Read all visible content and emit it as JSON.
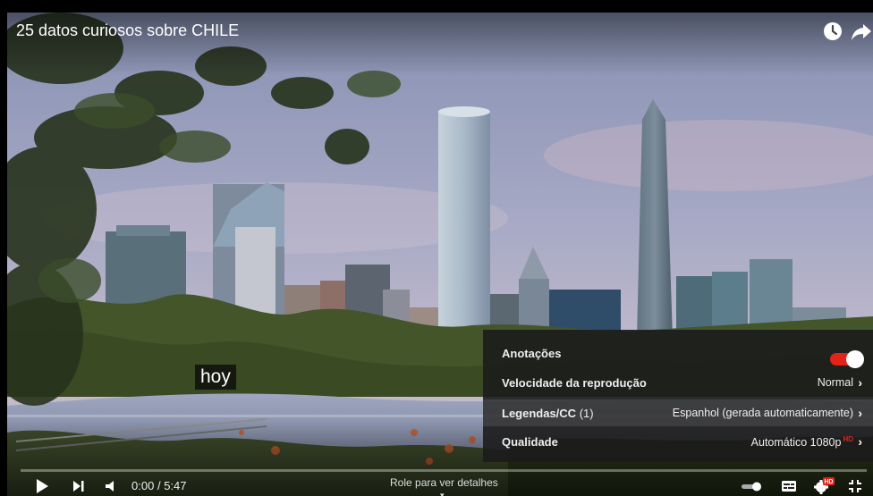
{
  "video": {
    "title": "25 datos curiosos sobre CHILE",
    "caption": "hoy",
    "time_current": "0:00",
    "time_separator": "/",
    "time_total": "5:47",
    "scroll_hint": "Role para ver detalhes",
    "progress": 0
  },
  "top_actions": [
    {
      "name": "watch-later-icon"
    },
    {
      "name": "share-icon"
    }
  ],
  "settings": {
    "annotations": {
      "label": "Anotações",
      "enabled": true
    },
    "speed": {
      "label": "Velocidade da reprodução",
      "value": "Normal"
    },
    "captions": {
      "label": "Legendas/CC",
      "count": "(1)",
      "value": "Espanhol (gerada automaticamente)"
    },
    "quality": {
      "label": "Qualidade",
      "value": "Automático 1080p",
      "badge": "HD"
    }
  },
  "controls": [
    {
      "name": "play-icon"
    },
    {
      "name": "next-icon"
    },
    {
      "name": "volume-icon"
    },
    {
      "name": "autoplay-toggle-icon"
    },
    {
      "name": "subtitles-icon"
    },
    {
      "name": "settings-gear-icon"
    },
    {
      "name": "exit-fullscreen-icon"
    }
  ],
  "colors": {
    "accent": "#e62117",
    "panel": "#1c1c1c"
  }
}
